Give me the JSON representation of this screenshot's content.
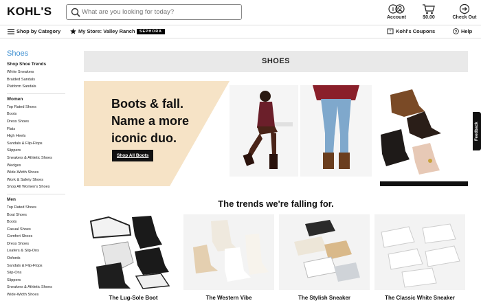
{
  "header": {
    "logo": "KOHL'S",
    "search_placeholder": "What are you looking for today?",
    "account_label": "Account",
    "cart_amount": "$0.00",
    "checkout_label": "Check Out"
  },
  "nav": {
    "shop_by_category": "Shop by Category",
    "my_store": "My Store: Valley Ranch",
    "sephora": "SEPHORA",
    "coupons": "Kohl's Coupons",
    "help": "Help"
  },
  "sidebar": {
    "title": "Shoes",
    "sections": [
      {
        "heading": "Shop Shoe Trends",
        "links": [
          "White Sneakers",
          "Braided Sandals",
          "Platform Sandals"
        ]
      },
      {
        "heading": "Women",
        "links": [
          "Top Rated Shoes",
          "Boots",
          "Dress Shoes",
          "Flats",
          "High Heels",
          "Sandals & Flip-Flops",
          "Slippers",
          "Sneakers & Athletic Shoes",
          "Wedges",
          "Wide-Width Shoes",
          "Work & Safety Shoes",
          "Shop All Women's Shoes"
        ]
      },
      {
        "heading": "Men",
        "links": [
          "Top Rated Shoes",
          "Boat Shoes",
          "Boots",
          "Casual Shoes",
          "Comfort Shoes",
          "Dress Shoes",
          "Loafers & Slip-Ons",
          "Oxfords",
          "Sandals & Flip-Flops",
          "Slip-Ons",
          "Slippers",
          "Sneakers & Athletic Shoes",
          "Wide-Width Shoes"
        ]
      }
    ]
  },
  "main": {
    "page_title": "SHOES",
    "hero_line1": "Boots & fall.",
    "hero_line2": "Name a more",
    "hero_line3": "iconic duo.",
    "hero_button": "Shop All Boots",
    "trends_heading": "The trends we're falling for.",
    "cards": [
      {
        "label": "The Lug-Sole Boot"
      },
      {
        "label": "The Western Vibe"
      },
      {
        "label": "The Stylish Sneaker"
      },
      {
        "label": "The Classic White Sneaker"
      }
    ]
  },
  "feedback_label": "Feedback"
}
